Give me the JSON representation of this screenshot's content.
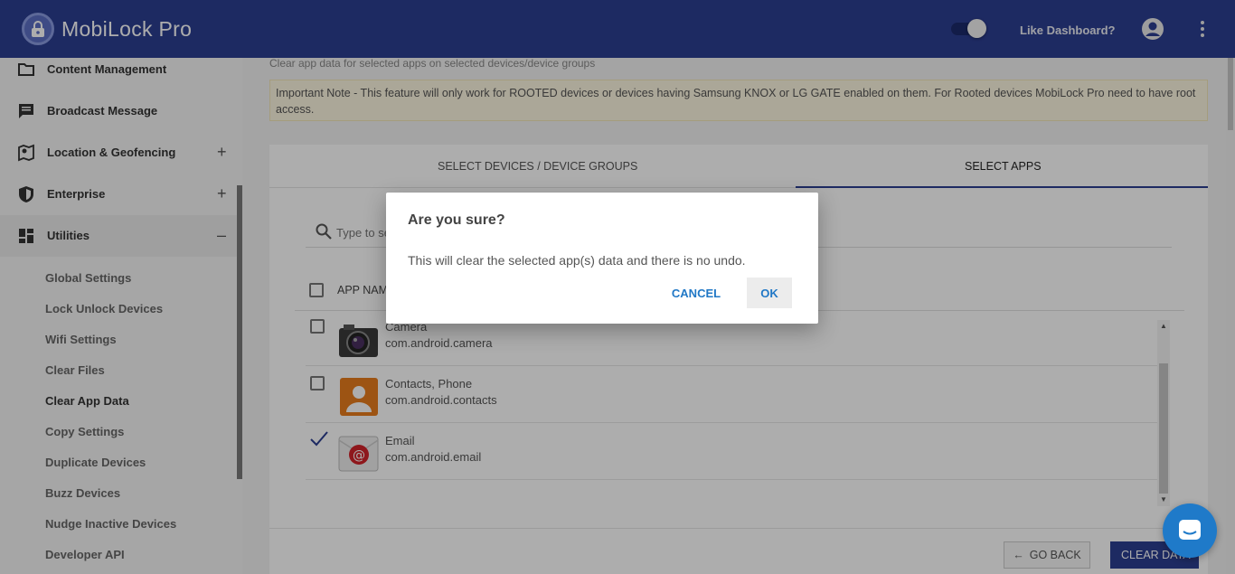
{
  "app": {
    "title": "MobiLock Pro"
  },
  "header": {
    "like_dashboard": "Like Dashboard?"
  },
  "sidebar": {
    "items": [
      {
        "label": "Content Management",
        "icon": "folder-icon"
      },
      {
        "label": "Broadcast Message",
        "icon": "message-icon"
      },
      {
        "label": "Location & Geofencing",
        "icon": "map-pin-icon",
        "expand": "+"
      },
      {
        "label": "Enterprise",
        "icon": "shield-icon",
        "expand": "+"
      },
      {
        "label": "Utilities",
        "icon": "dashboard-icon",
        "expand": "–"
      }
    ],
    "sub_items": [
      "Global Settings",
      "Lock Unlock Devices",
      "Wifi Settings",
      "Clear Files",
      "Clear App Data",
      "Copy Settings",
      "Duplicate Devices",
      "Buzz Devices",
      "Nudge Inactive Devices",
      "Developer API"
    ],
    "current_sub_item": "Clear App Data"
  },
  "main": {
    "subtitle": "Clear app data for selected apps on selected devices/device groups",
    "note": "Important Note - This feature will only work for ROOTED devices or devices having Samsung KNOX or LG GATE enabled on them. For Rooted devices MobiLock Pro need to have root access.",
    "tabs": [
      {
        "label": "SELECT DEVICES / DEVICE GROUPS",
        "selected": false
      },
      {
        "label": "SELECT APPS",
        "selected": true
      }
    ],
    "search": {
      "placeholder": "Type to search",
      "value": ""
    },
    "table": {
      "header": "APP NAME",
      "rows": [
        {
          "name": "Camera",
          "package": "com.android.camera",
          "checked": false,
          "icon": "camera-icon"
        },
        {
          "name": "Contacts, Phone",
          "package": "com.android.contacts",
          "checked": false,
          "icon": "contacts-icon"
        },
        {
          "name": "Email",
          "package": "com.android.email",
          "checked": true,
          "icon": "email-icon"
        }
      ]
    },
    "buttons": {
      "go_back": "GO BACK",
      "clear_data": "CLEAR DATA"
    }
  },
  "dialog": {
    "title": "Are you sure?",
    "message": "This will clear the selected app(s) data and there is no undo.",
    "cancel": "CANCEL",
    "ok": "OK"
  },
  "colors": {
    "primary": "#2c3e91",
    "accent": "#2178c6",
    "note_bg": "#fdf6e0",
    "chat": "#1f7ac9"
  }
}
